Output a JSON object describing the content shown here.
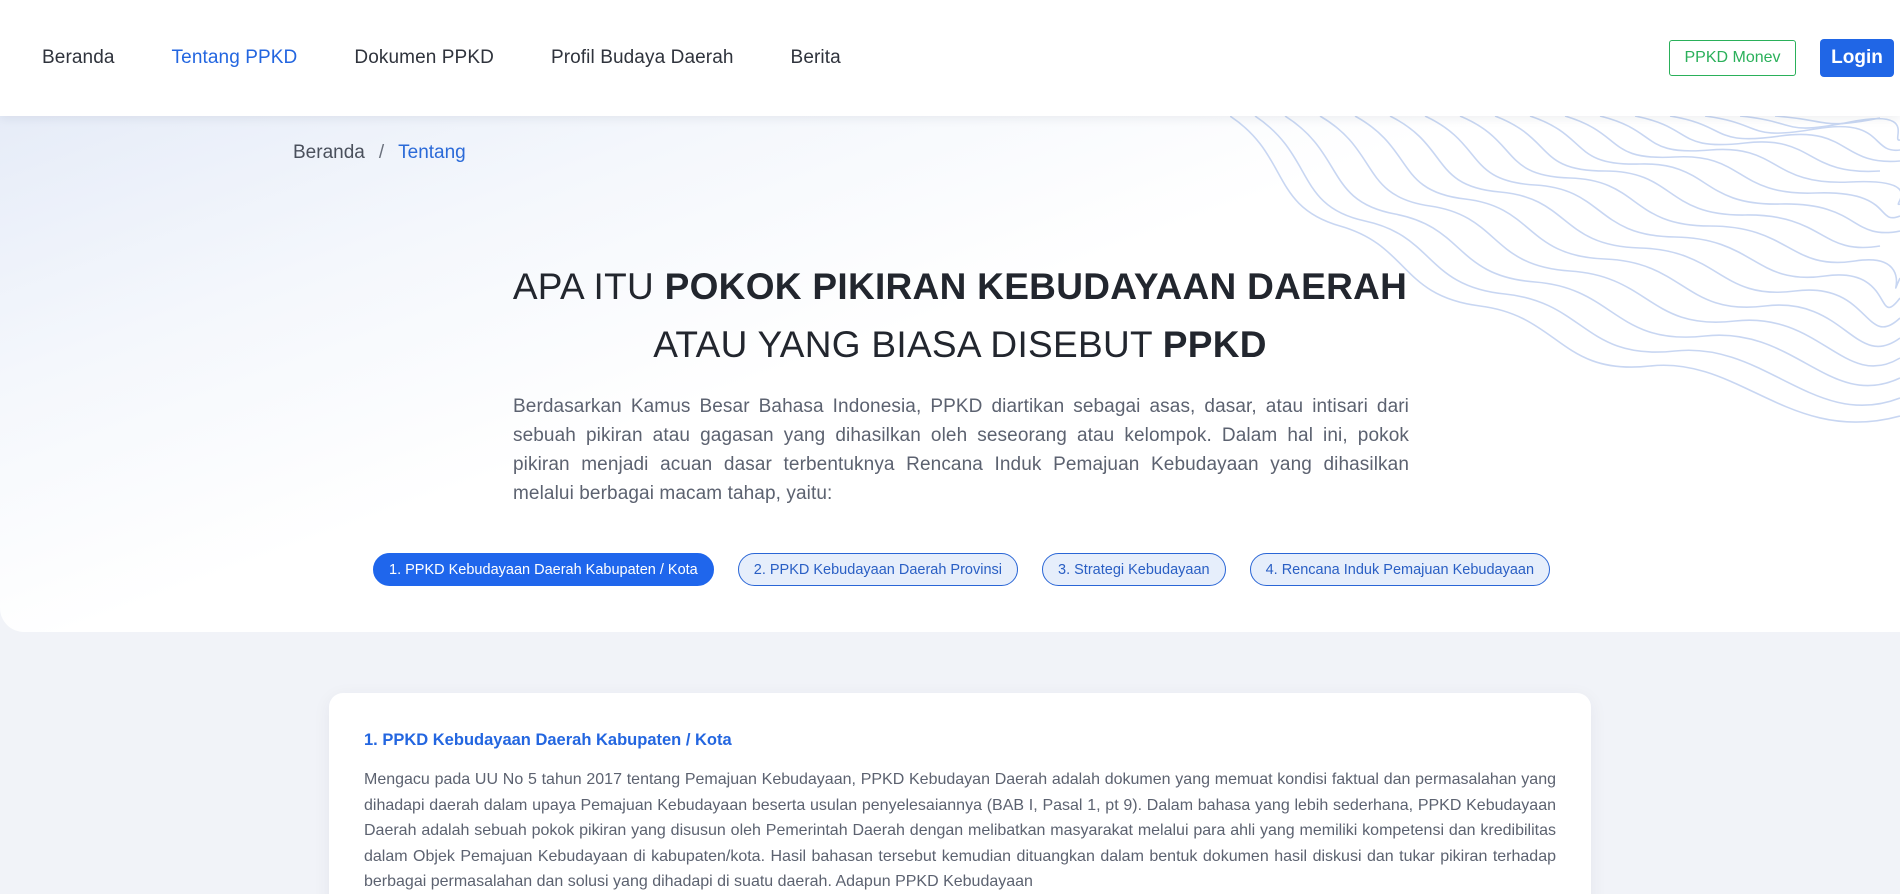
{
  "nav": {
    "links": [
      {
        "label": "Beranda"
      },
      {
        "label": "Tentang PPKD"
      },
      {
        "label": "Dokumen PPKD"
      },
      {
        "label": "Profil Budaya Daerah"
      },
      {
        "label": "Berita"
      }
    ],
    "monev_label": "PPKD Monev",
    "login_label": "Login"
  },
  "breadcrumb": {
    "home": "Beranda",
    "separator": "/",
    "current": "Tentang"
  },
  "hero": {
    "title_line1_prefix": "APA ITU ",
    "title_line1_bold": "POKOK PIKIRAN KEBUDAYAAN DAERAH",
    "title_line2_prefix": "ATAU YANG BIASA DISEBUT ",
    "title_line2_bold": "PPKD",
    "description": "Berdasarkan Kamus Besar Bahasa Indonesia, PPKD diartikan sebagai asas, dasar, atau intisari dari sebuah pikiran atau gagasan yang dihasilkan oleh seseorang atau kelompok. Dalam hal ini, pokok pikiran menjadi acuan dasar terbentuknya Rencana Induk Pemajuan Kebudayaan yang dihasilkan melalui berbagai macam tahap, yaitu:"
  },
  "tabs": [
    {
      "label": "1. PPKD Kebudayaan Daerah Kabupaten / Kota",
      "active": true
    },
    {
      "label": "2. PPKD Kebudayaan Daerah Provinsi",
      "active": false
    },
    {
      "label": "3. Strategi Kebudayaan",
      "active": false
    },
    {
      "label": "4. Rencana Induk Pemajuan Kebudayaan",
      "active": false
    }
  ],
  "card": {
    "title": "1. PPKD Kebudayaan Daerah Kabupaten / Kota",
    "body": "Mengacu pada UU No 5 tahun 2017 tentang Pemajuan Kebudayaan, PPKD Kebudayan Daerah adalah dokumen yang memuat kondisi faktual dan permasalahan yang dihadapi daerah dalam upaya Pemajuan Kebudayaan beserta usulan penyelesaiannya (BAB I, Pasal 1, pt 9). Dalam bahasa yang lebih sederhana, PPKD Kebudayaan Daerah adalah sebuah pokok pikiran yang disusun oleh Pemerintah Daerah dengan melibatkan masyarakat melalui para ahli yang memiliki kompetensi dan kredibilitas dalam Objek Pemajuan Kebudayaan di kabupaten/kota. Hasil bahasan tersebut kemudian dituangkan dalam bentuk dokumen hasil diskusi dan tukar pikiran terhadap berbagai permasalahan dan solusi yang dihadapi di suatu daerah. Adapun PPKD Kebudayaan"
  },
  "colors": {
    "accent": "#2066e6",
    "monev": "#2ab05a"
  }
}
